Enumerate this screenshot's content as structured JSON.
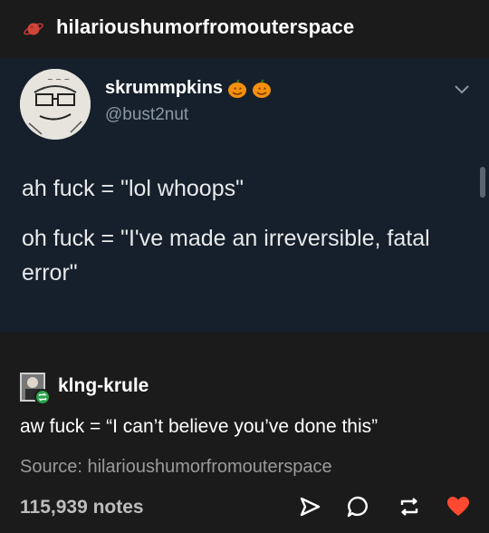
{
  "post": {
    "blog_name": "hilarioushumorfromouterspace"
  },
  "tweet": {
    "display_name": "skrummpkins",
    "handle": "@bust2nut",
    "line1": "ah fuck = \"lol whoops\"",
    "line2": "oh fuck = \"I've made an irreversible, fatal error\""
  },
  "reblog": {
    "username": "klng-krule",
    "text": "aw fuck = “I can’t believe you’ve done this”"
  },
  "source": {
    "text": "Source: hilarioushumorfromouterspace"
  },
  "footer": {
    "notes": "115,939 notes",
    "actions": [
      "share-icon",
      "reply-icon",
      "reblog-icon",
      "like-icon"
    ],
    "like_color": "#ff4930"
  },
  "colors": {
    "background": "#1b1b1b",
    "tweet_background": "#16202c",
    "reblog_badge": "#2aa34a"
  }
}
